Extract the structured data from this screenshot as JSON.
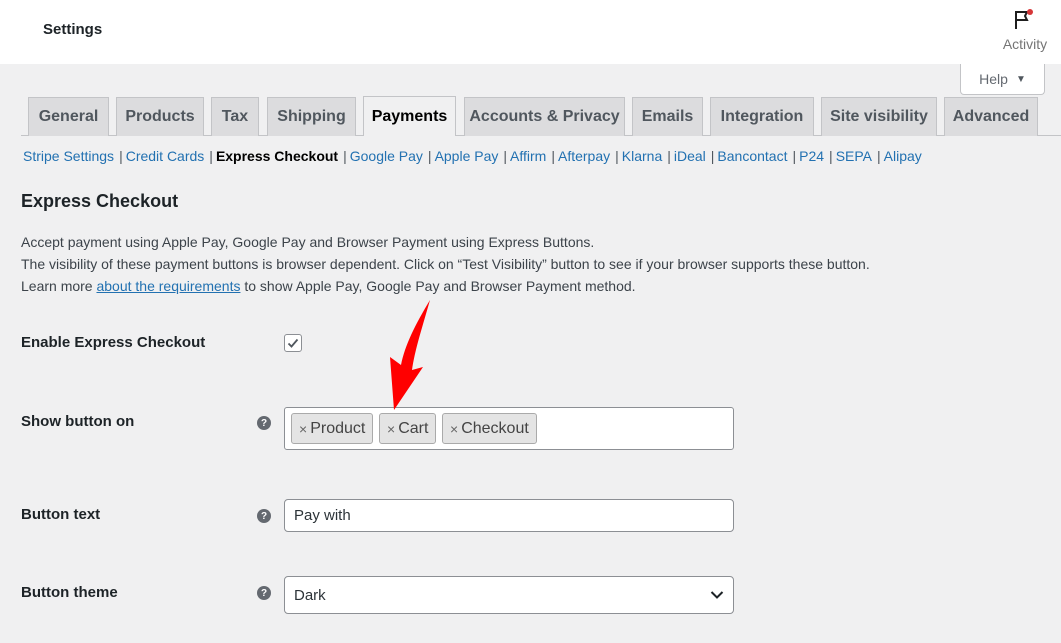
{
  "topbar": {
    "title": "Settings",
    "activity_label": "Activity"
  },
  "help": {
    "label": "Help",
    "arrow": "▼"
  },
  "tabs": [
    {
      "label": "General",
      "active": false
    },
    {
      "label": "Products",
      "active": false
    },
    {
      "label": "Tax",
      "active": false
    },
    {
      "label": "Shipping",
      "active": false
    },
    {
      "label": "Payments",
      "active": true
    },
    {
      "label": "Accounts & Privacy",
      "active": false
    },
    {
      "label": "Emails",
      "active": false
    },
    {
      "label": "Integration",
      "active": false
    },
    {
      "label": "Site visibility",
      "active": false
    },
    {
      "label": "Advanced",
      "active": false
    }
  ],
  "subnav": [
    "Stripe Settings",
    "Credit Cards",
    "Express Checkout",
    "Google Pay",
    "Apple Pay",
    "Affirm",
    "Afterpay",
    "Klarna",
    "iDeal",
    "Bancontact",
    "P24",
    "SEPA",
    "Alipay"
  ],
  "subnav_separator": "|",
  "section": {
    "title": "Express Checkout",
    "desc_line1": "Accept payment using Apple Pay, Google Pay and Browser Payment using Express Buttons.",
    "desc_line2": "The visibility of these payment buttons is browser dependent. Click on “Test Visibility” button to see if your browser supports these button.",
    "desc_line3_pre": "Learn more ",
    "desc_line3_link": "about the requirements",
    "desc_line3_post": " to show Apple Pay, Google Pay and Browser Payment method."
  },
  "fields": {
    "enable": {
      "label": "Enable Express Checkout",
      "checked": true
    },
    "show_on": {
      "label": "Show button on",
      "help": "?",
      "chips": [
        "Product",
        "Cart",
        "Checkout"
      ],
      "chip_remove": "×"
    },
    "button_text": {
      "label": "Button text",
      "help": "?",
      "value": "Pay with"
    },
    "button_theme": {
      "label": "Button theme",
      "help": "?",
      "value": "Dark"
    }
  },
  "icons": {
    "activity": "flag-icon",
    "help_tooltip": "question-circle-icon",
    "select": "chevron-down-icon",
    "check": "checkmark-icon"
  },
  "colors": {
    "accent": "#2271b1",
    "annotation": "#ff0000",
    "notification": "#d63638"
  }
}
